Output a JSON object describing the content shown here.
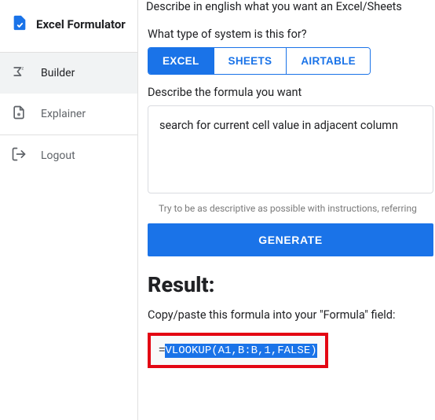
{
  "brand": {
    "title": "Excel Formulator"
  },
  "sidebar": {
    "items": [
      {
        "label": "Builder"
      },
      {
        "label": "Explainer"
      },
      {
        "label": "Logout"
      }
    ]
  },
  "main": {
    "topHelper": "Describe in english what you want an Excel/Sheets",
    "systemLabel": "What type of system is this for?",
    "systemOptions": [
      "EXCEL",
      "SHEETS",
      "AIRTABLE"
    ],
    "describeLabel": "Describe the formula you want",
    "describeValue": "search for current cell value in adjacent column",
    "hint": "Try to be as descriptive as possible with instructions, referring",
    "generateLabel": "GENERATE",
    "resultHeading": "Result:",
    "resultInstruction": "Copy/paste this formula into your \"Formula\" field:",
    "formulaPrefix": "=",
    "formulaBody": "VLOOKUP(A1,B:B,1,FALSE)"
  }
}
